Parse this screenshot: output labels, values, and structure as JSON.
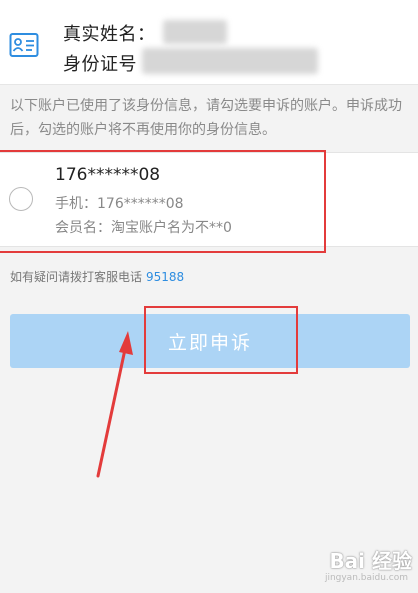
{
  "identity": {
    "name_label": "真实姓名：",
    "id_label": "身份证号"
  },
  "notice": {
    "text": "以下账户已使用了该身份信息，请勾选要申诉的账户。申诉成功后，勾选的账户将不再使用你的身份信息。"
  },
  "account": {
    "id": "176******08",
    "phone_label": "手机：",
    "phone": "176******08",
    "member_label": "会员名：",
    "member": "淘宝账户名为不**0",
    "selected": false
  },
  "hotline": {
    "text": "如有疑问请拨打客服电话",
    "phone": "95188"
  },
  "appeal_button": {
    "label": "立即申诉"
  },
  "watermark": {
    "main": "Bai 经验",
    "sub": "jingyan.baidu.com"
  },
  "colors": {
    "accent": "#2e8de0",
    "button_disabled": "#acd4f5",
    "annotation_red": "#e33b3b"
  }
}
